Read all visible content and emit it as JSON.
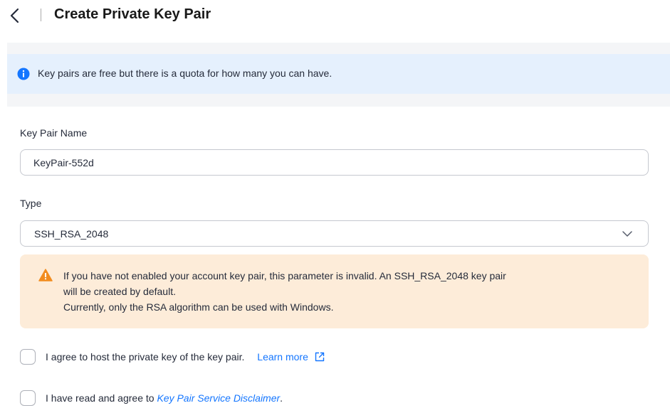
{
  "header": {
    "title": "Create Private Key Pair"
  },
  "info_banner": {
    "text": "Key pairs are free but there is a quota for how many you can have."
  },
  "form": {
    "name_label": "Key Pair Name",
    "name_value": "KeyPair-552d",
    "type_label": "Type",
    "type_value": "SSH_RSA_2048"
  },
  "warning": {
    "line1": "If you have not enabled your account key pair, this parameter is invalid. An SSH_RSA_2048 key pair",
    "line2": "will be created by default.",
    "line3": "Currently, only the RSA algorithm can be used with Windows."
  },
  "agree_host": {
    "text": "I agree to host the private key of the key pair.",
    "link": "Learn more"
  },
  "agree_disclaimer": {
    "prefix": "I have read and agree to ",
    "link": "Key Pair Service Disclaimer",
    "suffix": "."
  },
  "colors": {
    "accent": "#1476ff",
    "info_bg": "#e5f0fd",
    "warning_bg": "#fdecd9",
    "warning_icon": "#f28c1f"
  }
}
